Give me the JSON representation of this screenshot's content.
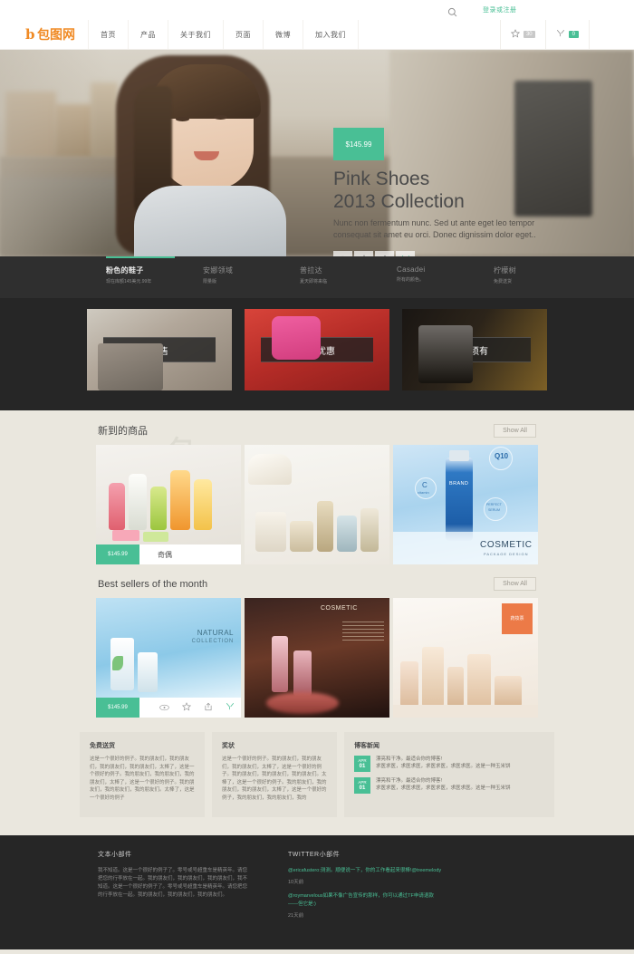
{
  "topbar": {
    "search_icon": "search-icon",
    "login_label": "登录或注册"
  },
  "header": {
    "logo_mark": "b",
    "logo_text": "包图网",
    "nav": [
      {
        "label": "首页"
      },
      {
        "label": "产品"
      },
      {
        "label": "关于我们"
      },
      {
        "label": "页面"
      },
      {
        "label": "微博"
      },
      {
        "label": "加入我们"
      }
    ],
    "wishlist": {
      "icon": "star-icon",
      "count": "30"
    },
    "cart": {
      "icon": "cart-icon",
      "count": "0"
    }
  },
  "hero": {
    "price": "$145.99",
    "title_line1": "Pink Shoes",
    "title_line2": "2013 Collection",
    "description": "Nunc non fermentum nunc. Sed ut ante eget leo tempor consequat sit amet eu orci. Donec dignissim dolor eget..",
    "actions": [
      {
        "icon": "eye-icon"
      },
      {
        "icon": "star-icon"
      },
      {
        "icon": "share-icon"
      },
      {
        "icon": "cart-icon"
      }
    ]
  },
  "category_strip": [
    {
      "title": "粉色的鞋子",
      "subtitle": "现在库额145美元.99年",
      "active": true
    },
    {
      "title": "安娜领域",
      "subtitle": "限量版",
      "active": false
    },
    {
      "title": "普拉达",
      "subtitle": "夏天即将来临",
      "active": false
    },
    {
      "title": "Casadei",
      "subtitle": "所有的颜色。",
      "active": false
    },
    {
      "title": "柠檬树",
      "subtitle": "免费送货",
      "active": false
    }
  ],
  "banners": [
    {
      "label": "销售"
    },
    {
      "label": "特别优惠"
    },
    {
      "label": "必须有"
    }
  ],
  "new_arrivals": {
    "title": "新到的商品",
    "show_all": "Show All",
    "products": [
      {
        "price": "$145.99",
        "name": "奇偶"
      },
      {
        "price": "",
        "name": ""
      },
      {
        "price": "",
        "name": ""
      }
    ],
    "product3_labels": {
      "q10": "Q10",
      "brand": "BRAND",
      "vitamin_c": "C",
      "vitamin_sub": "vitamin",
      "perfect": "PERFECT",
      "serum": "SERUM",
      "cosmetic": "COSMETIC",
      "package_design": "PACKAGE DESIGN"
    }
  },
  "best_sellers": {
    "title": "Best sellers of the month",
    "show_all": "Show All",
    "products": [
      {
        "price": "$145.99",
        "name": "",
        "labels": {
          "natural": "NATURAL",
          "collection": "COLLECTION"
        }
      },
      {
        "price": "",
        "name": "",
        "labels": {
          "cosmetic": "COSMETIC"
        }
      },
      {
        "price": "",
        "name": "",
        "badge": "药妆票"
      }
    ],
    "actions": [
      {
        "icon": "eye-icon"
      },
      {
        "icon": "star-icon"
      },
      {
        "icon": "share-icon"
      },
      {
        "icon": "cart-icon"
      }
    ]
  },
  "info_boxes": {
    "free_shipping": {
      "title": "免费送货",
      "body": "这是一个很好的例子。我的朋友们，我的朋友们，我的朋友们，我的朋友们，太棒了，这是一个很好的例子。我的朋友们，我的朋友们，我的朋友们，太棒了，这是一个很好的例子。我的朋友们，我的朋友们，我的朋友们。太棒了，这是一个很好的例子"
    },
    "awards": {
      "title": "奖状",
      "body": "这是一个很好的例子。我的朋友们，我的朋友们，我的朋友们，太棒了，这是一个很好的例子。我的朋友们，我的朋友们，我的朋友们。太棒了，这是一个很好的例子。我的朋友们，我的朋友们，我的朋友们，太棒了，这是一个很好的例子，我的朋友们，我的朋友们，我的"
    },
    "blog_news": {
      "title": "博客新闻",
      "items": [
        {
          "month": "APR",
          "day": "01",
          "line1": "漂亮和干净。最适合你的博客!",
          "line2": "求医求医，求医求医，求医求医，求医求医。这是一种玉米饼"
        },
        {
          "month": "APR",
          "day": "01",
          "line1": "漂亮和干净。最适合你的博客!",
          "line2": "求医求医，求医求医，求医求医，求医求医。这是一种玉米饼"
        }
      ]
    }
  },
  "footer": {
    "text_widget": {
      "title": "文本小部件",
      "body": "我不知道。这是一个很好的例子了。零号或号超重车是精英年。请您把您的行李放在一起。我的朋友们，我的朋友们，我的朋友们，我不知道。这是一个很好的例子了。零号或号超重车是精英年。请您把您的行李放在一起。我的朋友们，我的朋友们，我的朋友们。"
    },
    "twitter_widget": {
      "title": "TWITTER小部件",
      "tweets": [
        {
          "text": "@ericafustero:测测。顺便说一下，你的工作看起来很棒!@treemelody",
          "time": "10天前"
        },
        {
          "text": "@roymarvelous如果不像广告宣传的那样，你可以通过TF申请退款——但它是:)",
          "time": "21天前"
        }
      ]
    }
  },
  "colors": {
    "accent_green": "#49bf95",
    "brand_orange": "#f08a24",
    "dark": "#262626",
    "page_bg": "#eae7de"
  }
}
